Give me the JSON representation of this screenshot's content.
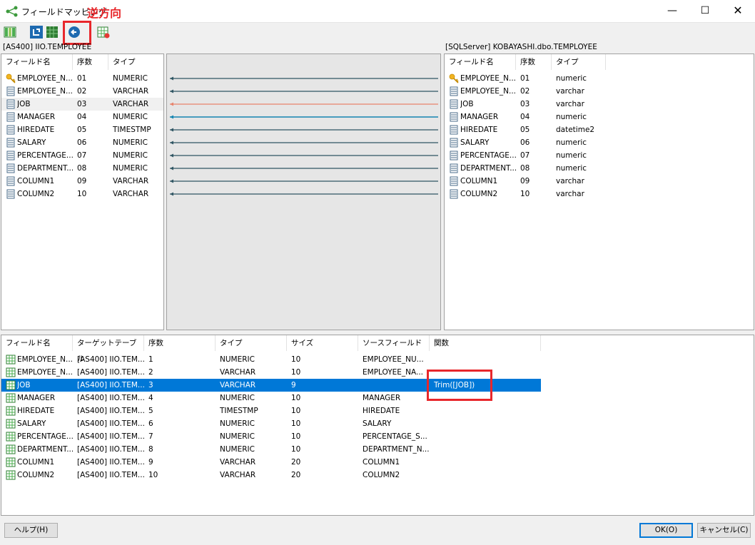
{
  "window": {
    "title": "フィールドマッピング",
    "annotation_label": "逆方向",
    "controls": {
      "minimize": "—",
      "maximize": "☐",
      "close": "✕"
    }
  },
  "toolbar": {
    "items": [
      "columns-view-icon",
      "mapping-mode-icon",
      "grid-view-icon",
      "reverse-direction-icon",
      "field-settings-icon"
    ]
  },
  "left_panel": {
    "caption": "[AS400] IIO.TEMPLOYEE",
    "headers": [
      "フィールド名",
      "序数",
      "タイプ"
    ],
    "rows": [
      {
        "name": "EMPLOYEE_N...",
        "ord": "01",
        "type": "NUMERIC",
        "key": true
      },
      {
        "name": "EMPLOYEE_N...",
        "ord": "02",
        "type": "VARCHAR",
        "key": false
      },
      {
        "name": "JOB",
        "ord": "03",
        "type": "VARCHAR",
        "key": false
      },
      {
        "name": "MANAGER",
        "ord": "04",
        "type": "NUMERIC",
        "key": false
      },
      {
        "name": "HIREDATE",
        "ord": "05",
        "type": "TIMESTMP",
        "key": false
      },
      {
        "name": "SALARY",
        "ord": "06",
        "type": "NUMERIC",
        "key": false
      },
      {
        "name": "PERCENTAGE...",
        "ord": "07",
        "type": "NUMERIC",
        "key": false
      },
      {
        "name": "DEPARTMENT...",
        "ord": "08",
        "type": "NUMERIC",
        "key": false
      },
      {
        "name": "COLUMN1",
        "ord": "09",
        "type": "VARCHAR",
        "key": false
      },
      {
        "name": "COLUMN2",
        "ord": "10",
        "type": "VARCHAR",
        "key": false
      }
    ]
  },
  "right_panel": {
    "caption": "[SQLServer] KOBAYASHI.dbo.TEMPLOYEE",
    "headers": [
      "フィールド名",
      "序数",
      "タイプ"
    ],
    "rows": [
      {
        "name": "EMPLOYEE_N...",
        "ord": "01",
        "type": "numeric",
        "key": true
      },
      {
        "name": "EMPLOYEE_N...",
        "ord": "02",
        "type": "varchar",
        "key": false
      },
      {
        "name": "JOB",
        "ord": "03",
        "type": "varchar",
        "key": false
      },
      {
        "name": "MANAGER",
        "ord": "04",
        "type": "numeric",
        "key": false
      },
      {
        "name": "HIREDATE",
        "ord": "05",
        "type": "datetime2",
        "key": false
      },
      {
        "name": "SALARY",
        "ord": "06",
        "type": "numeric",
        "key": false
      },
      {
        "name": "PERCENTAGE...",
        "ord": "07",
        "type": "numeric",
        "key": false
      },
      {
        "name": "DEPARTMENT...",
        "ord": "08",
        "type": "numeric",
        "key": false
      },
      {
        "name": "COLUMN1",
        "ord": "09",
        "type": "varchar",
        "key": false
      },
      {
        "name": "COLUMN2",
        "ord": "10",
        "type": "varchar",
        "key": false
      }
    ]
  },
  "mapping_lines": [
    {
      "color": "#2f5563"
    },
    {
      "color": "#2f5563"
    },
    {
      "color": "#e8836b"
    },
    {
      "color": "#1384b0"
    },
    {
      "color": "#2f5563"
    },
    {
      "color": "#2f5563"
    },
    {
      "color": "#2f5563"
    },
    {
      "color": "#2f5563"
    },
    {
      "color": "#2f5563"
    },
    {
      "color": "#2f5563"
    }
  ],
  "bottom_table": {
    "headers": [
      "フィールド名",
      "ターゲットテーブル",
      "序数",
      "タイプ",
      "サイズ",
      "ソースフィールド",
      "関数"
    ],
    "rows": [
      {
        "name": "EMPLOYEE_N...",
        "target": "[AS400] IIO.TEM...",
        "ord": "1",
        "type": "NUMERIC",
        "size": "10",
        "source": "EMPLOYEE_NU...",
        "func": ""
      },
      {
        "name": "EMPLOYEE_N...",
        "target": "[AS400] IIO.TEM...",
        "ord": "2",
        "type": "VARCHAR",
        "size": "10",
        "source": "EMPLOYEE_NA...",
        "func": ""
      },
      {
        "name": "JOB",
        "target": "[AS400] IIO.TEM...",
        "ord": "3",
        "type": "VARCHAR",
        "size": "9",
        "source": "",
        "func": "Trim([JOB])"
      },
      {
        "name": "MANAGER",
        "target": "[AS400] IIO.TEM...",
        "ord": "4",
        "type": "NUMERIC",
        "size": "10",
        "source": "MANAGER",
        "func": ""
      },
      {
        "name": "HIREDATE",
        "target": "[AS400] IIO.TEM...",
        "ord": "5",
        "type": "TIMESTMP",
        "size": "10",
        "source": "HIREDATE",
        "func": ""
      },
      {
        "name": "SALARY",
        "target": "[AS400] IIO.TEM...",
        "ord": "6",
        "type": "NUMERIC",
        "size": "10",
        "source": "SALARY",
        "func": ""
      },
      {
        "name": "PERCENTAGE...",
        "target": "[AS400] IIO.TEM...",
        "ord": "7",
        "type": "NUMERIC",
        "size": "10",
        "source": "PERCENTAGE_S...",
        "func": ""
      },
      {
        "name": "DEPARTMENT...",
        "target": "[AS400] IIO.TEM...",
        "ord": "8",
        "type": "NUMERIC",
        "size": "10",
        "source": "DEPARTMENT_N...",
        "func": ""
      },
      {
        "name": "COLUMN1",
        "target": "[AS400] IIO.TEM...",
        "ord": "9",
        "type": "VARCHAR",
        "size": "20",
        "source": "COLUMN1",
        "func": ""
      },
      {
        "name": "COLUMN2",
        "target": "[AS400] IIO.TEM...",
        "ord": "10",
        "type": "VARCHAR",
        "size": "20",
        "source": "COLUMN2",
        "func": ""
      }
    ]
  },
  "buttons": {
    "help": "ヘルプ(H)",
    "ok": "OK(O)",
    "cancel": "キャンセル(C)"
  }
}
